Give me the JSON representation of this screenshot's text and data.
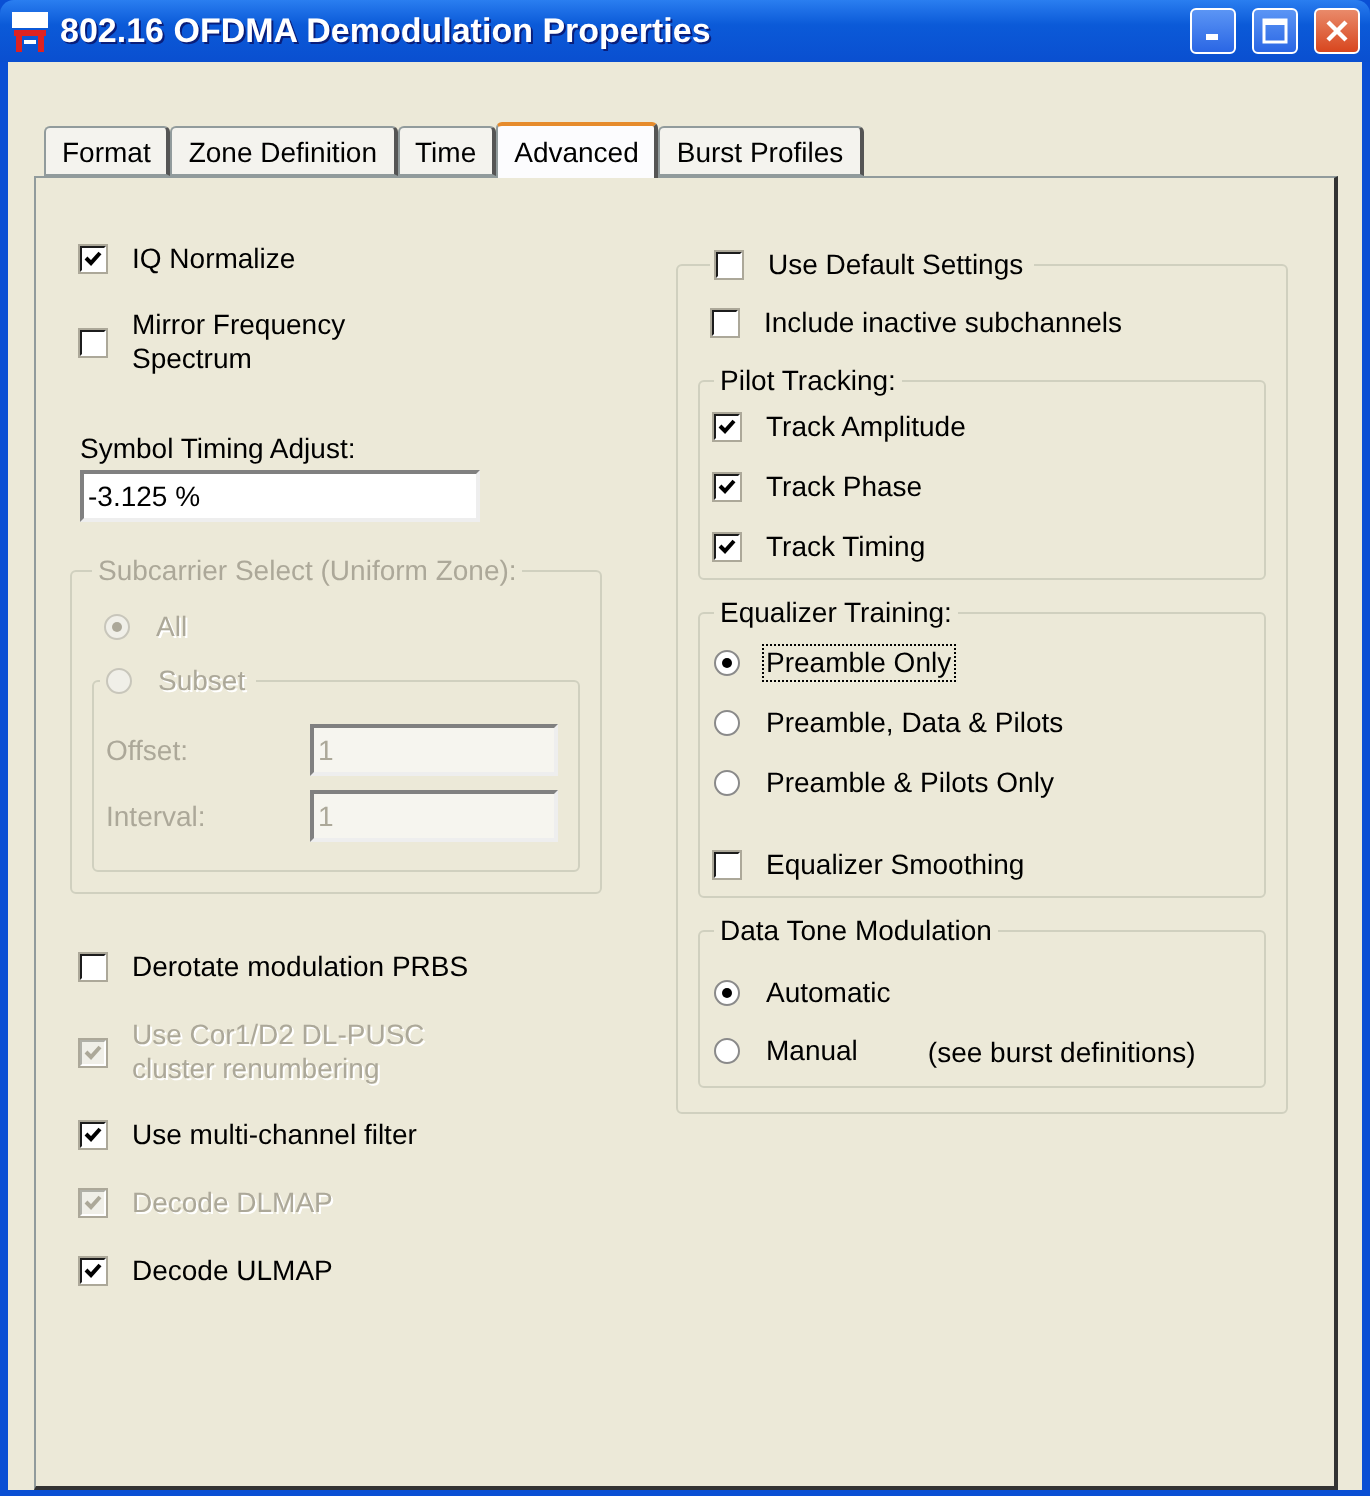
{
  "window": {
    "title": "802.16 OFDMA Demodulation Properties"
  },
  "tabs": [
    {
      "label": "Format",
      "selected": false
    },
    {
      "label": "Zone Definition",
      "selected": false
    },
    {
      "label": "Time",
      "selected": false
    },
    {
      "label": "Advanced",
      "selected": true
    },
    {
      "label": "Burst Profiles",
      "selected": false
    }
  ],
  "left_top": [
    {
      "label": "IQ Normalize",
      "checked": true,
      "disabled": false
    },
    {
      "label": "Mirror Frequency Spectrum",
      "checked": false,
      "disabled": false
    }
  ],
  "symbol_timing": {
    "label": "Symbol Timing Adjust:",
    "value": "-3.125 %"
  },
  "subcarrier_select": {
    "title": "Subcarrier Select (Uniform Zone):",
    "disabled": true,
    "all": {
      "label": "All",
      "selected": true
    },
    "subset": {
      "label": "Subset",
      "selected": false,
      "fields": [
        {
          "label": "Offset:",
          "value": "1"
        },
        {
          "label": "Interval:",
          "value": "1"
        }
      ]
    }
  },
  "left_bottom": [
    {
      "label": "Derotate modulation PRBS",
      "checked": false,
      "disabled": false
    },
    {
      "label": "Use Cor1/D2 DL-PUSC cluster renumbering",
      "checked": true,
      "disabled": true
    },
    {
      "label": "Use multi-channel filter",
      "checked": true,
      "disabled": false
    },
    {
      "label": "Decode DLMAP",
      "checked": true,
      "disabled": true
    },
    {
      "label": "Decode ULMAP",
      "checked": true,
      "disabled": false
    }
  ],
  "default_settings": {
    "label": "Use Default Settings",
    "checked": false,
    "include_inactive": {
      "label": "Include inactive subchannels",
      "checked": false
    },
    "pilot_tracking": {
      "title": "Pilot Tracking:",
      "items": [
        {
          "label": "Track Amplitude",
          "checked": true
        },
        {
          "label": "Track Phase",
          "checked": true
        },
        {
          "label": "Track Timing",
          "checked": true
        }
      ]
    },
    "equalizer_training": {
      "title": "Equalizer Training:",
      "options": [
        {
          "label": "Preamble Only",
          "selected": true,
          "focused": true
        },
        {
          "label": "Preamble, Data & Pilots",
          "selected": false,
          "focused": false
        },
        {
          "label": "Preamble & Pilots Only",
          "selected": false,
          "focused": false
        }
      ],
      "smoothing": {
        "label": "Equalizer Smoothing",
        "checked": false
      }
    },
    "data_tone_modulation": {
      "title": "Data Tone Modulation",
      "options": [
        {
          "label": "Automatic",
          "selected": true
        },
        {
          "label": "Manual",
          "selected": false,
          "note": "(see burst definitions)"
        }
      ]
    }
  }
}
